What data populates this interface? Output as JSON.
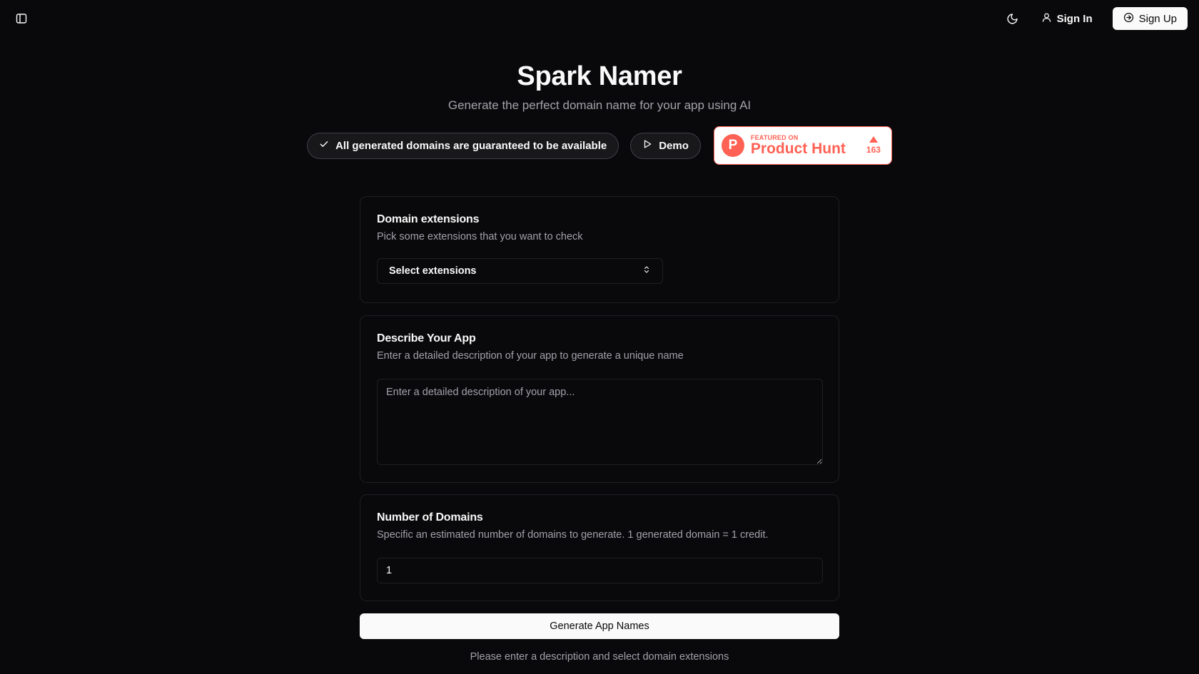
{
  "header": {
    "sidebar_toggle_icon": "panel-left-icon",
    "theme_icon": "moon-icon",
    "sign_in_label": "Sign In",
    "sign_up_label": "Sign Up"
  },
  "hero": {
    "title": "Spark Namer",
    "subtitle": "Generate the perfect domain name for your app using AI",
    "guarantee_label": "All generated domains are guaranteed to be available",
    "demo_label": "Demo",
    "product_hunt": {
      "small": "FEATURED ON",
      "big": "Product Hunt",
      "logo_letter": "P",
      "votes": "163",
      "color": "#ff6154"
    }
  },
  "extensions_card": {
    "title": "Domain extensions",
    "description": "Pick some extensions that you want to check",
    "select_label": "Select extensions"
  },
  "describe_card": {
    "title": "Describe Your App",
    "description": "Enter a detailed description of your app to generate a unique name",
    "placeholder": "Enter a detailed description of your app..."
  },
  "number_card": {
    "title": "Number of Domains",
    "description": "Specific an estimated number of domains to generate. 1 generated domain = 1 credit.",
    "value": "1"
  },
  "actions": {
    "generate_label": "Generate App Names",
    "hint": "Please enter a description and select domain extensions"
  }
}
